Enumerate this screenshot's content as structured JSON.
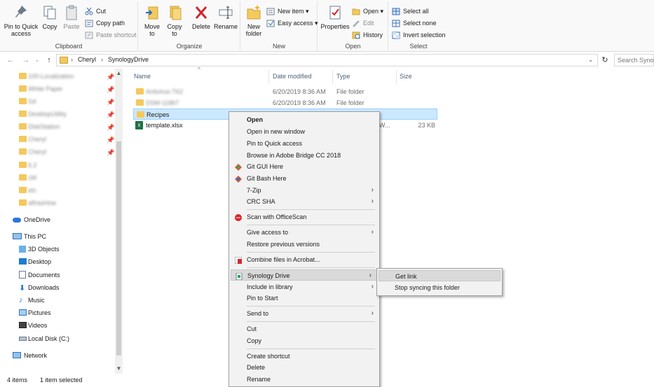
{
  "ribbon": {
    "clipboard": {
      "label": "Clipboard",
      "pin_label": "Pin to Quick access",
      "copy_label": "Copy",
      "paste_label": "Paste",
      "cut_label": "Cut",
      "copy_path_label": "Copy path",
      "paste_shortcut_label": "Paste shortcut"
    },
    "organize": {
      "label": "Organize",
      "move_to_label": "Move to",
      "copy_to_label": "Copy to",
      "delete_label": "Delete",
      "rename_label": "Rename"
    },
    "new": {
      "label": "New",
      "new_folder_label": "New folder",
      "new_item_label": "New item",
      "easy_access_label": "Easy access"
    },
    "open": {
      "label": "Open",
      "properties_label": "Properties",
      "open_label": "Open",
      "edit_label": "Edit",
      "history_label": "History"
    },
    "select": {
      "label": "Select",
      "select_all_label": "Select all",
      "select_none_label": "Select none",
      "invert_label": "Invert selection"
    }
  },
  "address": {
    "crumbs": [
      "Cheryl",
      "SynologyDrive"
    ],
    "search_placeholder": "Search Synol"
  },
  "nav": {
    "quick_access": [
      "100-Localization",
      "White Paper",
      "Git",
      "DesktopUtility",
      "DiskStation",
      "Cheryl",
      "Cheryl",
      "6.2",
      "cM",
      "etc",
      "alfrasHow"
    ],
    "onedrive": "OneDrive",
    "this_pc": "This PC",
    "pc_items": [
      "3D Objects",
      "Desktop",
      "Documents",
      "Downloads",
      "Music",
      "Pictures",
      "Videos",
      "Local Disk (C:)"
    ],
    "network": "Network"
  },
  "columns": {
    "name": "Name",
    "date": "Date modified",
    "type": "Type",
    "size": "Size"
  },
  "files": [
    {
      "name": "Antivirus-T62",
      "date": "6/20/2019 8:36 AM",
      "type": "File folder",
      "size": ""
    },
    {
      "name": "DSM-11867",
      "date": "6/20/2019 8:36 AM",
      "type": "File folder",
      "size": ""
    },
    {
      "name": "Recipes",
      "date": "",
      "type": "",
      "size": ""
    },
    {
      "name": "template.xlsx",
      "date": "",
      "type": "W...",
      "size": "23 KB"
    }
  ],
  "status": {
    "items": "4 items",
    "selected": "1 item selected"
  },
  "context_menu": {
    "open": "Open",
    "open_new_window": "Open in new window",
    "pin_quick": "Pin to Quick access",
    "browse_bridge": "Browse in Adobe Bridge CC 2018",
    "git_gui": "Git GUI Here",
    "git_bash": "Git Bash Here",
    "zip": "7-Zip",
    "crc": "CRC SHA",
    "officescan": "Scan with OfficeScan",
    "give_access": "Give access to",
    "restore": "Restore previous versions",
    "combine": "Combine files in Acrobat...",
    "synology": "Synology Drive",
    "library": "Include in library",
    "pin_start": "Pin to Start",
    "send_to": "Send to",
    "cut": "Cut",
    "copy": "Copy",
    "create_shortcut": "Create shortcut",
    "delete": "Delete",
    "rename": "Rename"
  },
  "submenu": {
    "get_link": "Get link",
    "stop_sync": "Stop syncing this folder"
  },
  "colors": {
    "accent": "#0078d7",
    "selection": "#cce8ff",
    "folder": "#f4c95d"
  }
}
